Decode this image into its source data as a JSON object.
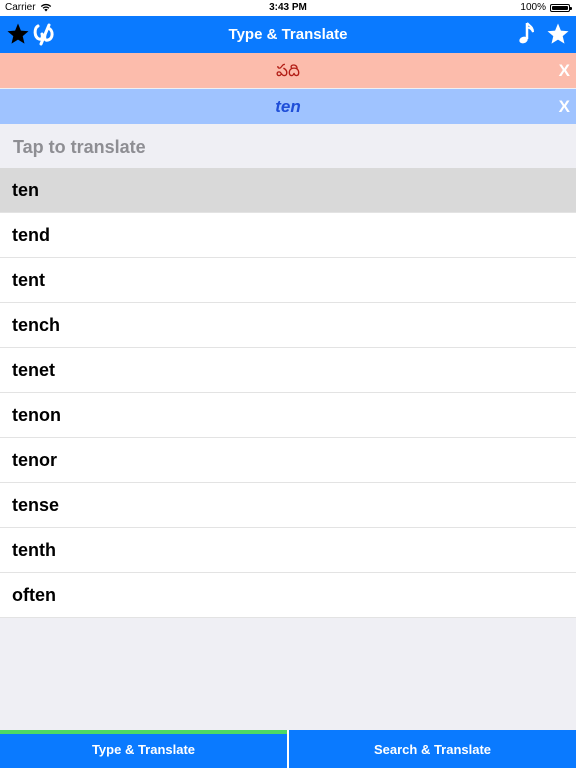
{
  "status_bar": {
    "carrier": "Carrier",
    "time": "3:43 PM",
    "battery": "100%"
  },
  "nav": {
    "title": "Type & Translate",
    "left_icons": [
      "star-icon",
      "app-logo-icon"
    ],
    "right_icons": [
      "music-note-icon",
      "star-icon"
    ]
  },
  "translation": {
    "target_text": "పది",
    "source_text": "ten",
    "close_label": "X"
  },
  "input": {
    "placeholder": "Tap to translate",
    "value": ""
  },
  "suggestions": [
    "ten",
    "tend",
    "tent",
    "tench",
    "tenet",
    "tenon",
    "tenor",
    "tense",
    "tenth",
    "often"
  ],
  "selected_index": 0,
  "tabs": [
    {
      "label": "Type & Translate",
      "active": true
    },
    {
      "label": "Search & Translate",
      "active": false
    }
  ],
  "colors": {
    "accent": "#0a7aff",
    "target_bar": "#fcbcac",
    "source_bar": "#9fc3ff",
    "active_tab_indicator": "#4cd964"
  }
}
